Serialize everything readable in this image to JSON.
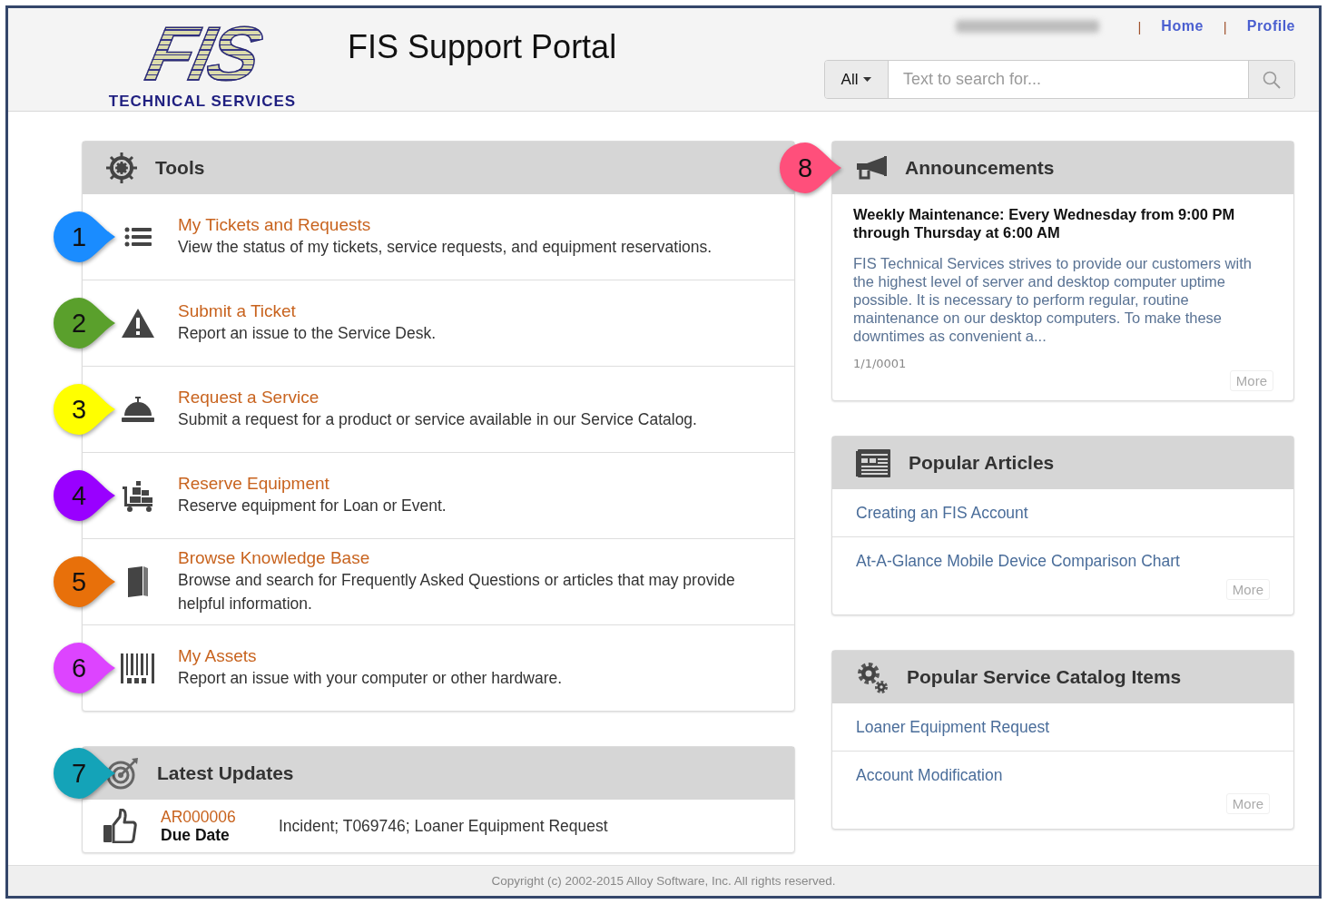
{
  "header": {
    "logo": {
      "mark": "FIS",
      "tagline": "TECHNICAL SERVICES"
    },
    "title": "FIS Support Portal",
    "nav": [
      {
        "separator": "|",
        "label": "Home"
      },
      {
        "separator": "|",
        "label": "Profile"
      }
    ],
    "search": {
      "scope": "All",
      "placeholder": "Text to search for..."
    }
  },
  "tools": {
    "title": "Tools",
    "items": [
      {
        "title": "My Tickets and Requests",
        "description": "View the status of my tickets, service requests, and equipment reservations.",
        "callout": {
          "label": "1",
          "color": "#1a8cff"
        }
      },
      {
        "title": "Submit a Ticket",
        "description": "Report an issue to the Service Desk.",
        "callout": {
          "label": "2",
          "color": "#5aa02c"
        }
      },
      {
        "title": "Request a Service",
        "description": "Submit a request for a product or service available in our Service Catalog.",
        "callout": {
          "label": "3",
          "color": "#ffff00"
        }
      },
      {
        "title": "Reserve Equipment",
        "description": "Reserve equipment for Loan or Event.",
        "callout": {
          "label": "4",
          "color": "#9900ff"
        }
      },
      {
        "title": "Browse Knowledge Base",
        "description": "Browse and search for Frequently Asked Questions or articles that may provide helpful information.",
        "callout": {
          "label": "5",
          "color": "#e8700a"
        }
      },
      {
        "title": "My Assets",
        "description": "Report an issue with your computer or other hardware.",
        "callout": {
          "label": "6",
          "color": "#dd44ff"
        }
      }
    ]
  },
  "latest_updates": {
    "title": "Latest Updates",
    "callout": {
      "label": "7",
      "color": "#14a3b8"
    },
    "items": [
      {
        "id": "AR000006",
        "field": "Due Date",
        "summary": "Incident; T069746; Loaner Equipment Request"
      }
    ]
  },
  "announcements": {
    "title": "Announcements",
    "callout": {
      "label": "8",
      "color": "#ff4f7b"
    },
    "items": [
      {
        "headline": "Weekly Maintenance: Every Wednesday from 9:00 PM through Thursday at 6:00 AM",
        "body": "FIS Technical Services strives to provide our customers with the highest level of server and desktop computer uptime possible. It is necessary to perform regular, routine maintenance on our desktop computers. To make these downtimes as convenient a...",
        "date": "1/1/0001"
      }
    ],
    "more": "More"
  },
  "popular_articles": {
    "title": "Popular Articles",
    "items": [
      "Creating an FIS Account",
      "At-A-Glance Mobile Device Comparison Chart"
    ],
    "more": "More"
  },
  "popular_catalog_items": {
    "title": "Popular Service Catalog Items",
    "items": [
      "Loaner Equipment Request",
      "Account Modification"
    ],
    "more": "More"
  },
  "footer": "Copyright (c) 2002-2015 Alloy Software, Inc. All rights reserved."
}
